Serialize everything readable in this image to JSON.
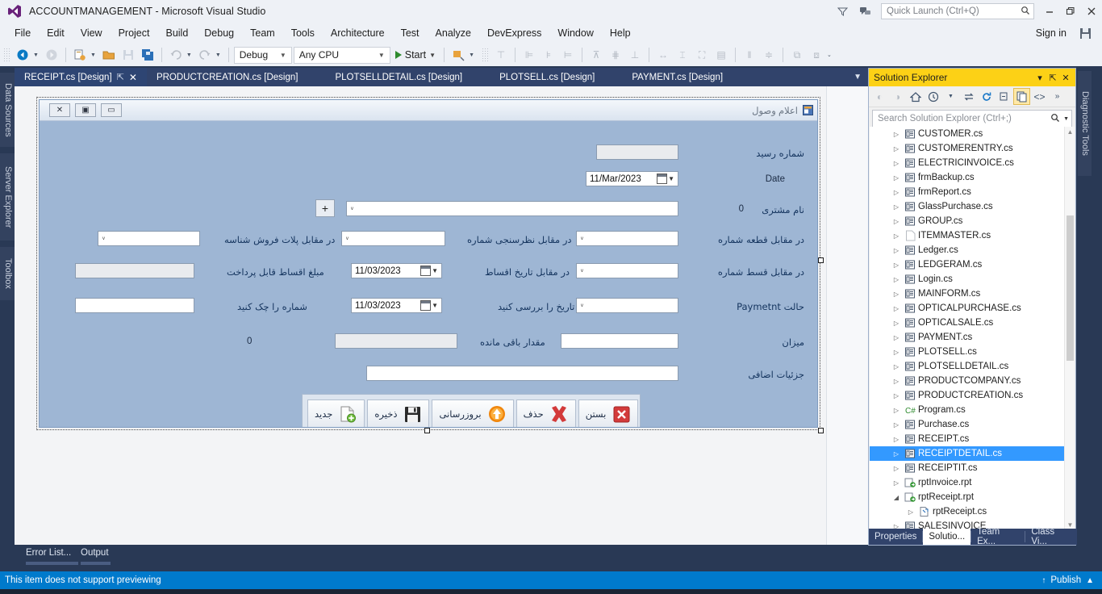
{
  "window": {
    "title": "ACCOUNTMANAGEMENT - Microsoft Visual Studio",
    "logo_icon": "visual-studio-logo",
    "minimize_icon": "minimize-icon",
    "restore_icon": "restore-icon",
    "close_icon": "close-icon",
    "filter_icon": "funnel-icon",
    "feedback_icon": "feedback-icon",
    "sign_in": "Sign in",
    "save_settings_icon": "save-settings-icon"
  },
  "quick_launch": {
    "placeholder": "Quick Launch (Ctrl+Q)",
    "search_icon": "search-icon"
  },
  "menu": {
    "items": [
      {
        "label": "File"
      },
      {
        "label": "Edit"
      },
      {
        "label": "View"
      },
      {
        "label": "Project"
      },
      {
        "label": "Build"
      },
      {
        "label": "Debug"
      },
      {
        "label": "Team"
      },
      {
        "label": "Tools"
      },
      {
        "label": "Architecture"
      },
      {
        "label": "Test"
      },
      {
        "label": "Analyze"
      },
      {
        "label": "DevExpress"
      },
      {
        "label": "Window"
      },
      {
        "label": "Help"
      }
    ]
  },
  "toolbar": {
    "navigate_back_icon": "navigate-back-icon",
    "navigate_forward_icon": "navigate-forward-icon",
    "new_project_icon": "new-project-icon",
    "open_file_icon": "open-file-icon",
    "save_icon": "save-icon",
    "save_all_icon": "save-all-icon",
    "undo_icon": "undo-icon",
    "redo_icon": "redo-icon",
    "configuration": "Debug",
    "platform": "Any CPU",
    "start_label": "Start",
    "start_icon": "play-icon",
    "attach_icon": "attach-to-process-icon",
    "align_lefts_icon": "align-lefts-icon",
    "align_centers_icon": "align-centers-icon",
    "align_rights_icon": "align-rights-icon",
    "align_tops_icon": "align-tops-icon",
    "align_middles_icon": "align-middles-icon",
    "align_bottoms_icon": "align-bottoms-icon",
    "make_same_width_icon": "make-same-width-icon",
    "make_same_height_icon": "make-same-height-icon",
    "make_same_size_icon": "make-same-size-icon",
    "size_to_grid_icon": "size-to-grid-icon",
    "horizontal_spacing_icon": "horizontal-spacing-icon",
    "vertical_spacing_icon": "vertical-spacing-icon",
    "bring_to_front_icon": "bring-to-front-icon",
    "send_to_back_icon": "send-to-back-icon"
  },
  "left_dock": {
    "tabs": [
      {
        "label": "Data Sources"
      },
      {
        "label": "Server Explorer"
      },
      {
        "label": "Toolbox"
      }
    ]
  },
  "right_dock": {
    "tabs": [
      {
        "label": "Diagnostic Tools"
      }
    ]
  },
  "document_tabs": [
    {
      "label": "RECEIPT.cs [Design]",
      "active": true,
      "pin_icon": "pin-icon",
      "close_icon": "close-icon"
    },
    {
      "label": "PRODUCTCREATION.cs [Design]",
      "active": false
    },
    {
      "label": "PLOTSELLDETAIL.cs [Design]",
      "active": false
    },
    {
      "label": "PLOTSELL.cs [Design]",
      "active": false
    },
    {
      "label": "PAYMENT.cs [Design]",
      "active": false
    }
  ],
  "tabstrip_overflow_icon": "chevron-down-icon",
  "designer_form": {
    "title": "اعلام وصول",
    "title_icon": "form-icon",
    "window_controls": [
      {
        "name": "close-box",
        "glyph": "✕"
      },
      {
        "name": "maximize-box",
        "glyph": "▣"
      },
      {
        "name": "minimize-box",
        "glyph": "▭"
      }
    ],
    "fields": [
      {
        "label": "شماره رسید",
        "control": "textbox",
        "value": "",
        "readonly": true
      },
      {
        "label": "Date",
        "control": "datepicker",
        "value": "11/Mar/2023"
      },
      {
        "label": "نام مشتری",
        "control": "combobox",
        "value": "",
        "extra_value": "0",
        "add_button": "+"
      },
      {
        "label": "در مقابل قطعه شماره",
        "control": "combobox",
        "value": ""
      },
      {
        "label": "در مقابل نظرسنجی شماره",
        "control": "combobox",
        "value": ""
      },
      {
        "label": "در مقابل پلات فروش شناسه",
        "control": "combobox",
        "value": ""
      },
      {
        "label": "در مقابل قسط شماره",
        "control": "combobox",
        "value": ""
      },
      {
        "label": "در مقابل تاریخ اقساط",
        "control": "datepicker",
        "value": "11/03/2023"
      },
      {
        "label": "مبلغ اقساط قابل پرداخت",
        "control": "textbox",
        "value": "",
        "readonly": true
      },
      {
        "label": "حالت Paymetnt",
        "control": "combobox",
        "value": ""
      },
      {
        "label": "تاریخ را بررسی کنید",
        "control": "datepicker",
        "value": "11/03/2023"
      },
      {
        "label": "شماره را چک کنید",
        "control": "textbox",
        "value": ""
      },
      {
        "label": "میزان",
        "control": "textbox",
        "value": ""
      },
      {
        "label": "مقدار باقی مانده",
        "control": "textbox",
        "value": "",
        "readonly": true,
        "extra_value": "0"
      },
      {
        "label": "جزئیات اضافی",
        "control": "textbox",
        "value": ""
      }
    ],
    "buttons": [
      {
        "label": "جدید",
        "icon": "new-document-icon"
      },
      {
        "label": "ذخیره",
        "icon": "floppy-save-icon"
      },
      {
        "label": "بروزرسانی",
        "icon": "refresh-up-arrow-icon"
      },
      {
        "label": "حذف",
        "icon": "red-x-delete-icon"
      },
      {
        "label": "بستن",
        "icon": "red-close-box-icon"
      }
    ]
  },
  "solution_explorer": {
    "title": "Solution Explorer",
    "dropdown_icon": "chevron-down-icon",
    "pin_icon": "pin-icon",
    "close_icon": "close-icon",
    "toolbar_icons": [
      "back-icon",
      "forward-icon",
      "home-icon",
      "pending-changes-icon",
      "sync-with-active-document-icon",
      "refresh-icon",
      "collapse-all-icon",
      "show-all-files-icon",
      "view-code-icon",
      "overflow-icon"
    ],
    "search_placeholder": "Search Solution Explorer (Ctrl+;)",
    "search_icon": "search-icon",
    "search_dropdown_icon": "chevron-down-icon",
    "tree": [
      {
        "label": "CUSTOMER.cs",
        "icon": "form-file-icon",
        "level": 1,
        "expander": "collapsed"
      },
      {
        "label": "CUSTOMERENTRY.cs",
        "icon": "form-file-icon",
        "level": 1,
        "expander": "collapsed"
      },
      {
        "label": "ELECTRICINVOICE.cs",
        "icon": "form-file-icon",
        "level": 1,
        "expander": "collapsed"
      },
      {
        "label": "frmBackup.cs",
        "icon": "form-file-icon",
        "level": 1,
        "expander": "collapsed"
      },
      {
        "label": "frmReport.cs",
        "icon": "form-file-icon",
        "level": 1,
        "expander": "collapsed"
      },
      {
        "label": "GlassPurchase.cs",
        "icon": "form-file-icon",
        "level": 1,
        "expander": "collapsed"
      },
      {
        "label": "GROUP.cs",
        "icon": "form-file-icon",
        "level": 1,
        "expander": "collapsed"
      },
      {
        "label": "ITEMMASTER.cs",
        "icon": "blank-file-icon",
        "level": 1,
        "expander": "collapsed"
      },
      {
        "label": "Ledger.cs",
        "icon": "form-file-icon",
        "level": 1,
        "expander": "collapsed"
      },
      {
        "label": "LEDGERAM.cs",
        "icon": "form-file-icon",
        "level": 1,
        "expander": "collapsed"
      },
      {
        "label": "Login.cs",
        "icon": "form-file-icon",
        "level": 1,
        "expander": "collapsed"
      },
      {
        "label": "MAINFORM.cs",
        "icon": "form-file-icon",
        "level": 1,
        "expander": "collapsed"
      },
      {
        "label": "OPTICALPURCHASE.cs",
        "icon": "form-file-icon",
        "level": 1,
        "expander": "collapsed"
      },
      {
        "label": "OPTICALSALE.cs",
        "icon": "form-file-icon",
        "level": 1,
        "expander": "collapsed"
      },
      {
        "label": "PAYMENT.cs",
        "icon": "form-file-icon",
        "level": 1,
        "expander": "collapsed"
      },
      {
        "label": "PLOTSELL.cs",
        "icon": "form-file-icon",
        "level": 1,
        "expander": "collapsed"
      },
      {
        "label": "PLOTSELLDETAIL.cs",
        "icon": "form-file-icon",
        "level": 1,
        "expander": "collapsed"
      },
      {
        "label": "PRODUCTCOMPANY.cs",
        "icon": "form-file-icon",
        "level": 1,
        "expander": "collapsed"
      },
      {
        "label": "PRODUCTCREATION.cs",
        "icon": "form-file-icon",
        "level": 1,
        "expander": "collapsed"
      },
      {
        "label": "Program.cs",
        "icon": "csharp-file-icon",
        "level": 1,
        "expander": "collapsed"
      },
      {
        "label": "Purchase.cs",
        "icon": "form-file-icon",
        "level": 1,
        "expander": "collapsed"
      },
      {
        "label": "RECEIPT.cs",
        "icon": "form-file-icon",
        "level": 1,
        "expander": "collapsed"
      },
      {
        "label": "RECEIPTDETAIL.cs",
        "icon": "form-file-icon",
        "level": 1,
        "expander": "collapsed",
        "selected": true
      },
      {
        "label": "RECEIPTIT.cs",
        "icon": "form-file-icon",
        "level": 1,
        "expander": "collapsed"
      },
      {
        "label": "rptInvoice.rpt",
        "icon": "report-file-icon",
        "level": 1,
        "expander": "collapsed"
      },
      {
        "label": "rptReceipt.rpt",
        "icon": "report-file-icon",
        "level": 1,
        "expander": "expanded"
      },
      {
        "label": "rptReceipt.cs",
        "icon": "code-file-icon",
        "level": 2,
        "expander": "collapsed"
      },
      {
        "label": "SALESINVOICE",
        "icon": "form-file-icon",
        "level": 1,
        "expander": "collapsed"
      }
    ],
    "scroll_up_icon": "scroll-up-arrow",
    "scroll_down_icon": "scroll-down-arrow",
    "bottom_tabs": [
      {
        "label": "Properties",
        "active": false
      },
      {
        "label": "Solutio...",
        "active": true
      },
      {
        "label": "Team Ex...",
        "active": false
      },
      {
        "label": "Class Vi...",
        "active": false
      }
    ]
  },
  "bottom_dock": {
    "tabs": [
      {
        "label": "Error List..."
      },
      {
        "label": "Output"
      }
    ]
  },
  "status_bar": {
    "message": "This item does not support previewing",
    "publish_label": "Publish",
    "publish_up_icon": "arrow-up-icon",
    "publish_caret_icon": "caret-up-icon"
  },
  "colors": {
    "accent": "#007acc",
    "solution_header": "#fcd116",
    "selection": "#3399ff",
    "chrome": "#293955"
  }
}
